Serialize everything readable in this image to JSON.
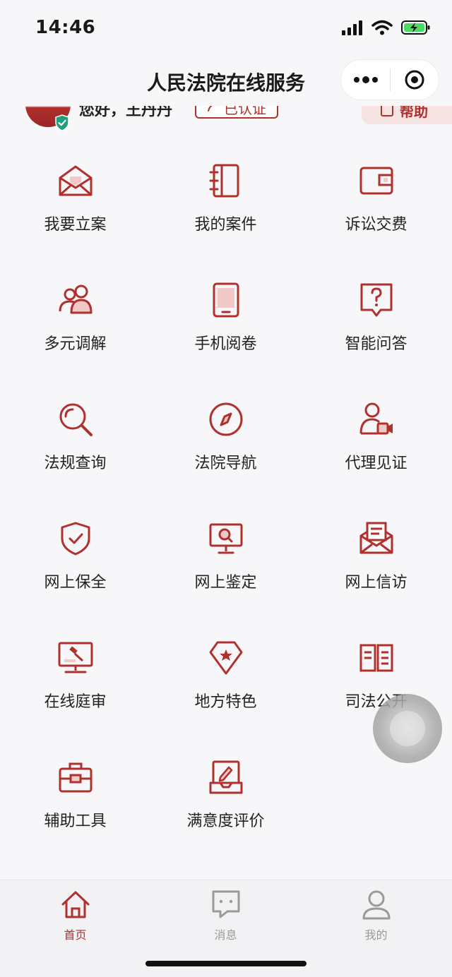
{
  "status_bar": {
    "time": "14:46"
  },
  "nav": {
    "title": "人民法院在线服务"
  },
  "user": {
    "greeting": "您好，王丹丹",
    "verify_label": "已认证",
    "help_label": "帮助"
  },
  "grid": [
    {
      "label": "我要立案",
      "icon": "envelope-open-icon"
    },
    {
      "label": "我的案件",
      "icon": "notebook-icon"
    },
    {
      "label": "诉讼交费",
      "icon": "wallet-icon"
    },
    {
      "label": "多元调解",
      "icon": "people-icon"
    },
    {
      "label": "手机阅卷",
      "icon": "mobile-icon"
    },
    {
      "label": "智能问答",
      "icon": "question-bubble-icon"
    },
    {
      "label": "法规查询",
      "icon": "magnifier-icon"
    },
    {
      "label": "法院导航",
      "icon": "compass-icon"
    },
    {
      "label": "代理见证",
      "icon": "person-video-icon"
    },
    {
      "label": "网上保全",
      "icon": "shield-check-icon"
    },
    {
      "label": "网上鉴定",
      "icon": "monitor-search-icon"
    },
    {
      "label": "网上信访",
      "icon": "mail-letter-icon"
    },
    {
      "label": "在线庭审",
      "icon": "monitor-gavel-icon"
    },
    {
      "label": "地方特色",
      "icon": "diamond-star-icon"
    },
    {
      "label": "司法公开",
      "icon": "open-book-icon"
    },
    {
      "label": "辅助工具",
      "icon": "toolbox-icon"
    },
    {
      "label": "满意度评价",
      "icon": "pen-tray-icon"
    }
  ],
  "tabs": [
    {
      "label": "首页",
      "icon": "home-icon",
      "active": true
    },
    {
      "label": "消息",
      "icon": "message-icon",
      "active": false
    },
    {
      "label": "我的",
      "icon": "user-icon",
      "active": false
    }
  ],
  "colors": {
    "accent": "#b0302e",
    "tab_inactive": "#9a9a9a",
    "background": "#f7f7f9"
  }
}
